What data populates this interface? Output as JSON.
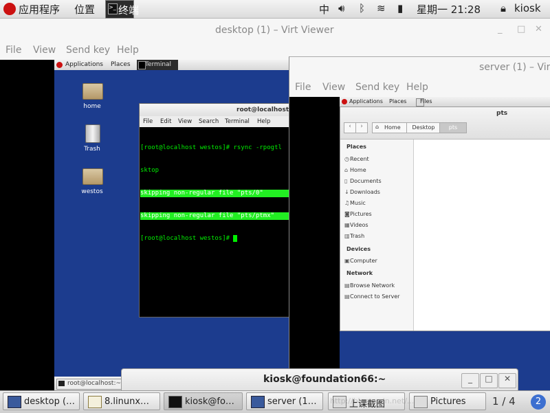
{
  "topbar": {
    "apps_label": "应用程序",
    "places_label": "位置",
    "terminal_label": "终端",
    "input_method": "中",
    "clock": "星期一 21:28",
    "user": "kiosk"
  },
  "desktop_viewer": {
    "title": "desktop (1) – Virt Viewer",
    "menu": [
      "File",
      "View",
      "Send key",
      "Help"
    ],
    "guest": {
      "panel": {
        "applications": "Applications",
        "places": "Places",
        "terminal": "Terminal"
      },
      "icons": [
        "home",
        "Trash",
        "westos"
      ],
      "terminal": {
        "title": "root@localhost:~",
        "menu": [
          "File",
          "Edit",
          "View",
          "Search",
          "Terminal",
          "Help"
        ],
        "lines": [
          "[root@localhost westos]# rsync -rpogtl",
          "sktop",
          "skipping non-regular file \"pts/0\"",
          "skipping non-regular file \"pts/ptmx\"",
          "[root@localhost westos]# "
        ]
      },
      "taskbar_item": "root@localhost:~"
    }
  },
  "server_viewer": {
    "title": "server (1) – Vir",
    "menu": [
      "File",
      "View",
      "Send key",
      "Help"
    ],
    "guest": {
      "panel": {
        "applications": "Applications",
        "places": "Places",
        "files": "Files"
      },
      "window_title": "pts",
      "path": [
        "Home",
        "Desktop",
        "pts"
      ],
      "sidebar": {
        "places_head": "Places",
        "places": [
          "Recent",
          "Home",
          "Documents",
          "Downloads",
          "Music",
          "Pictures",
          "Videos",
          "Trash"
        ],
        "devices_head": "Devices",
        "devices": [
          "Computer"
        ],
        "network_head": "Network",
        "network": [
          "Browse Network",
          "Connect to Server"
        ]
      }
    }
  },
  "kiosk_terminal": {
    "title": "kiosk@foundation66:~"
  },
  "taskbar": {
    "items": [
      "desktop (…",
      "8.linunx…",
      "kiosk@fo…",
      "server (1…",
      "上课截图",
      "Pictures"
    ],
    "pager": "1 / 4",
    "badge": "2",
    "watermark": "http://blog.csdn.net/..."
  },
  "colors": {
    "guest_desktop": "#1c3c8e",
    "terminal_bg": "#000000",
    "terminal_green": "#00ff00",
    "highlight": "#22ee22"
  }
}
